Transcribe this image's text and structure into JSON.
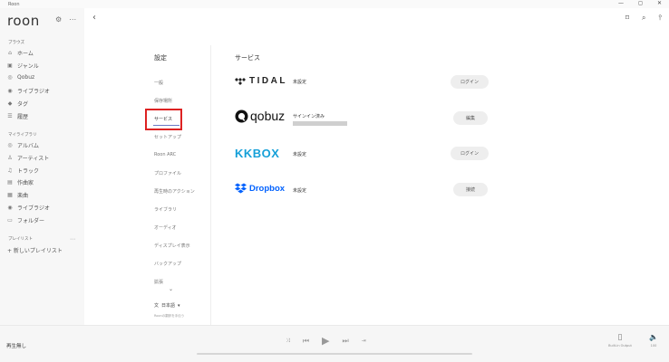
{
  "window": {
    "title": "Roon",
    "controls": [
      "—",
      "◻",
      "✕"
    ]
  },
  "app": {
    "brand": "roon"
  },
  "sidebar": {
    "browse_label": "ブラウズ",
    "browse_items": [
      {
        "label": "ホーム",
        "icon": "home-icon"
      },
      {
        "label": "ジャンル",
        "icon": "genre-icon"
      },
      {
        "label": "Qobuz",
        "icon": "qobuz-icon"
      },
      {
        "label": "ライブラジオ",
        "icon": "radio-icon"
      },
      {
        "label": "タグ",
        "icon": "tag-icon"
      },
      {
        "label": "履歴",
        "icon": "history-icon"
      }
    ],
    "library_label": "マイライブラリ",
    "library_items": [
      {
        "label": "アルバム",
        "icon": "album-icon"
      },
      {
        "label": "アーティスト",
        "icon": "artist-icon"
      },
      {
        "label": "トラック",
        "icon": "track-icon"
      },
      {
        "label": "作曲家",
        "icon": "composer-icon"
      },
      {
        "label": "楽曲",
        "icon": "composition-icon"
      },
      {
        "label": "ライブラジオ",
        "icon": "radio-icon"
      },
      {
        "label": "フォルダー",
        "icon": "folder-icon"
      }
    ],
    "playlists_label": "プレイリスト",
    "new_playlist": "+ 新しいプレイリスト"
  },
  "settings": {
    "title": "設定",
    "items": [
      "一般",
      "保存場所",
      "サービス",
      "セットアップ",
      "Roon ARC",
      "プロファイル",
      "再生時のアクション",
      "ライブラリ",
      "オーディオ",
      "ディスプレイ表示",
      "バックアップ",
      "拡張"
    ],
    "active_index": 2,
    "language": "日本語",
    "language_help": "Roonの翻訳を手伝う"
  },
  "services": {
    "title": "サービス",
    "list": [
      {
        "name": "TIDAL",
        "status": "未設定",
        "button": "ログイン"
      },
      {
        "name": "qobuz",
        "status": "サインイン済み",
        "button": "編集"
      },
      {
        "name": "KKBOX",
        "status": "未設定",
        "button": "ログイン"
      },
      {
        "name": "Dropbox",
        "status": "未設定",
        "button": "接続"
      }
    ]
  },
  "footer": {
    "now_playing": "再生無し",
    "zone_label": "Built-in Output",
    "volume_label": "100"
  },
  "colors": {
    "accent_underline": "#6b79c6",
    "highlight_box": "#dd2222",
    "kkbox": "#16a0d8",
    "dropbox": "#0061fe"
  }
}
